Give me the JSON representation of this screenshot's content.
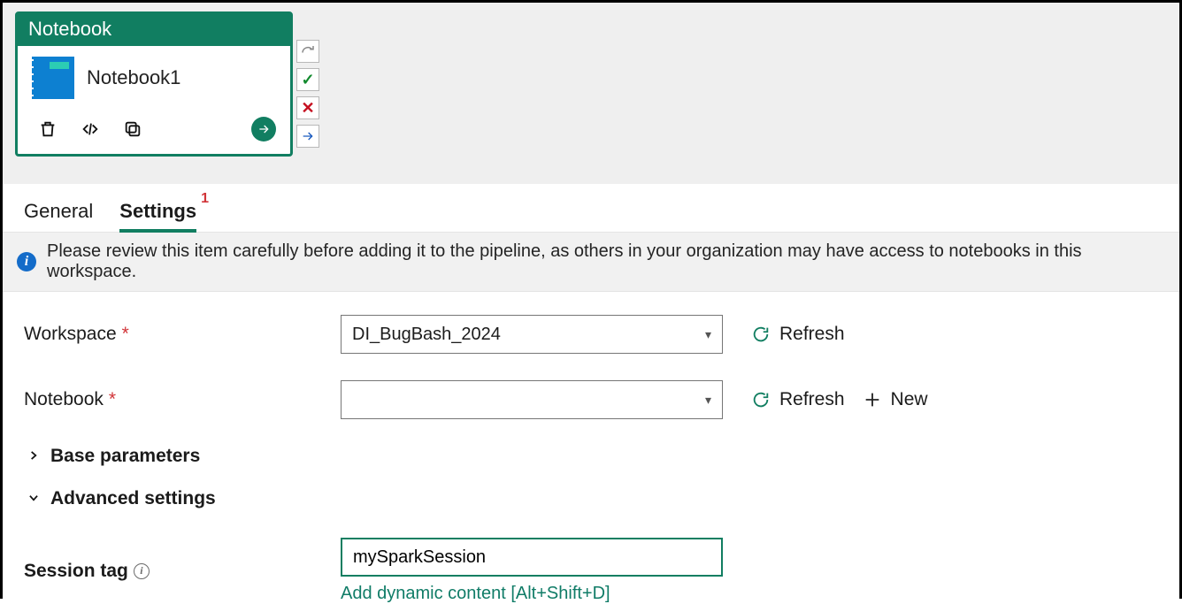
{
  "activity": {
    "type_label": "Notebook",
    "name": "Notebook1",
    "icons": {
      "notebook": "notebook-icon",
      "delete": "trash-icon",
      "code": "code-icon",
      "copy": "copy-icon",
      "run": "arrow-right-circle-icon"
    }
  },
  "side_toolbar": {
    "redo": "redo-icon",
    "validate": "check-icon",
    "cancel": "x-icon",
    "next": "arrow-right-icon"
  },
  "tabs": {
    "general": "General",
    "settings": "Settings",
    "settings_badge": "1"
  },
  "info_bar": {
    "text": "Please review this item carefully before adding it to the pipeline, as others in your organization may have access to notebooks in this workspace."
  },
  "form": {
    "workspace": {
      "label": "Workspace",
      "value": "DI_BugBash_2024",
      "refresh_label": "Refresh"
    },
    "notebook": {
      "label": "Notebook",
      "value": "",
      "refresh_label": "Refresh",
      "new_label": "New"
    },
    "base_parameters_label": "Base parameters",
    "advanced_settings_label": "Advanced settings",
    "session_tag": {
      "label": "Session tag",
      "value": "mySparkSession",
      "dynamic_link": "Add dynamic content [Alt+Shift+D]"
    }
  }
}
